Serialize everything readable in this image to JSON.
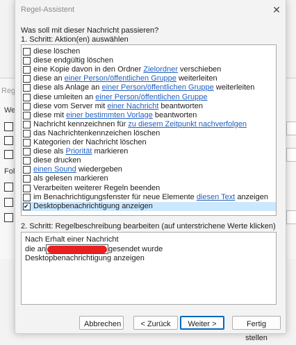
{
  "background_window": {
    "title_fragment": "Regel",
    "label_1": "We",
    "label_2": "Fol"
  },
  "dialog": {
    "title": "Regel-Assistent",
    "close_glyph": "✕",
    "question": "Was soll mit dieser Nachricht passieren?",
    "step1_label": "1. Schritt: Aktion(en) auswählen",
    "actions": [
      {
        "checked": false,
        "parts": [
          {
            "t": "diese löschen"
          }
        ]
      },
      {
        "checked": false,
        "parts": [
          {
            "t": "diese endgültig löschen"
          }
        ]
      },
      {
        "checked": false,
        "parts": [
          {
            "t": "eine Kopie davon in den Ordner "
          },
          {
            "t": "Zielordner",
            "link": true
          },
          {
            "t": " verschieben"
          }
        ]
      },
      {
        "checked": false,
        "parts": [
          {
            "t": "diese an "
          },
          {
            "t": "einer Person/öffentlichen Gruppe",
            "link": true
          },
          {
            "t": " weiterleiten"
          }
        ]
      },
      {
        "checked": false,
        "parts": [
          {
            "t": "diese als Anlage an "
          },
          {
            "t": "einer Person/öffentlichen Gruppe",
            "link": true
          },
          {
            "t": " weiterleiten"
          }
        ]
      },
      {
        "checked": false,
        "parts": [
          {
            "t": "diese umleiten an "
          },
          {
            "t": "einer Person/öffentlichen Gruppe",
            "link": true
          }
        ]
      },
      {
        "checked": false,
        "parts": [
          {
            "t": "diese vom Server mit "
          },
          {
            "t": "einer Nachricht",
            "link": true
          },
          {
            "t": " beantworten"
          }
        ]
      },
      {
        "checked": false,
        "parts": [
          {
            "t": "diese mit "
          },
          {
            "t": "einer bestimmten Vorlage",
            "link": true
          },
          {
            "t": " beantworten"
          }
        ]
      },
      {
        "checked": false,
        "parts": [
          {
            "t": "Nachricht kennzeichnen für "
          },
          {
            "t": "zu diesem Zeitpunkt nachverfolgen",
            "link": true
          }
        ]
      },
      {
        "checked": false,
        "parts": [
          {
            "t": "das Nachrichtenkennzeichen löschen"
          }
        ]
      },
      {
        "checked": false,
        "parts": [
          {
            "t": "Kategorien der Nachricht löschen"
          }
        ]
      },
      {
        "checked": false,
        "parts": [
          {
            "t": "diese als "
          },
          {
            "t": "Priorität",
            "link": true
          },
          {
            "t": " markieren"
          }
        ]
      },
      {
        "checked": false,
        "parts": [
          {
            "t": "diese drucken"
          }
        ]
      },
      {
        "checked": false,
        "parts": [
          {
            "t": "einen Sound",
            "link": true
          },
          {
            "t": " wiedergeben"
          }
        ]
      },
      {
        "checked": false,
        "parts": [
          {
            "t": "als gelesen markieren"
          }
        ]
      },
      {
        "checked": false,
        "parts": [
          {
            "t": "Verarbeiten weiterer Regeln beenden"
          }
        ]
      },
      {
        "checked": false,
        "parts": [
          {
            "t": "im Benachrichtigungsfenster für neue Elemente "
          },
          {
            "t": "diesen Text",
            "link": true
          },
          {
            "t": " anzeigen"
          }
        ]
      },
      {
        "checked": true,
        "selected": true,
        "parts": [
          {
            "t": "Desktopbenachrichtigung anzeigen"
          }
        ]
      }
    ],
    "step2_label": "2. Schritt: Regelbeschreibung bearbeiten (auf unterstrichene Werte klicken)",
    "description": {
      "line1": "Nach Erhalt einer Nachricht",
      "line2_prefix": "die an",
      "line2_suffix": "gesendet wurde",
      "line3": "Desktopbenachrichtigung anzeigen"
    },
    "buttons": {
      "cancel": "Abbrechen",
      "back": "< Zurück",
      "next": "Weiter >",
      "finish": "Fertig stellen"
    }
  },
  "colors": {
    "link": "#1f5fbf",
    "selection": "#cce8ff",
    "redaction": "#e82020",
    "primary_border": "#0067c0"
  }
}
